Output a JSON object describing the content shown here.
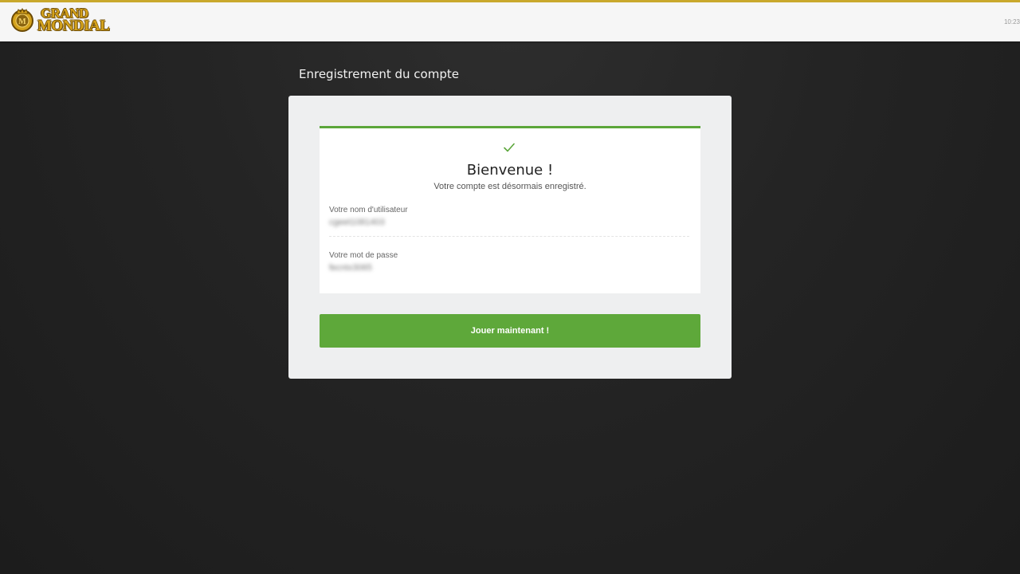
{
  "header": {
    "logo_line1": "GRAND",
    "logo_line2": "MONDIAL",
    "time": "10:23"
  },
  "page": {
    "title": "Enregistrement du compte"
  },
  "confirmation": {
    "icon": "check-icon",
    "title": "Bienvenue !",
    "subtitle": "Votre compte est désormais enregistré.",
    "username_label": "Votre nom d'utilisateur",
    "username_value": "cgeet1081403",
    "password_label": "Votre mot de passe",
    "password_value": "fecntx3065"
  },
  "actions": {
    "play_label": "Jouer maintenant !"
  },
  "colors": {
    "accent_green": "#5ea83a",
    "brand_gold": "#d4a21c",
    "background": "#242424"
  }
}
